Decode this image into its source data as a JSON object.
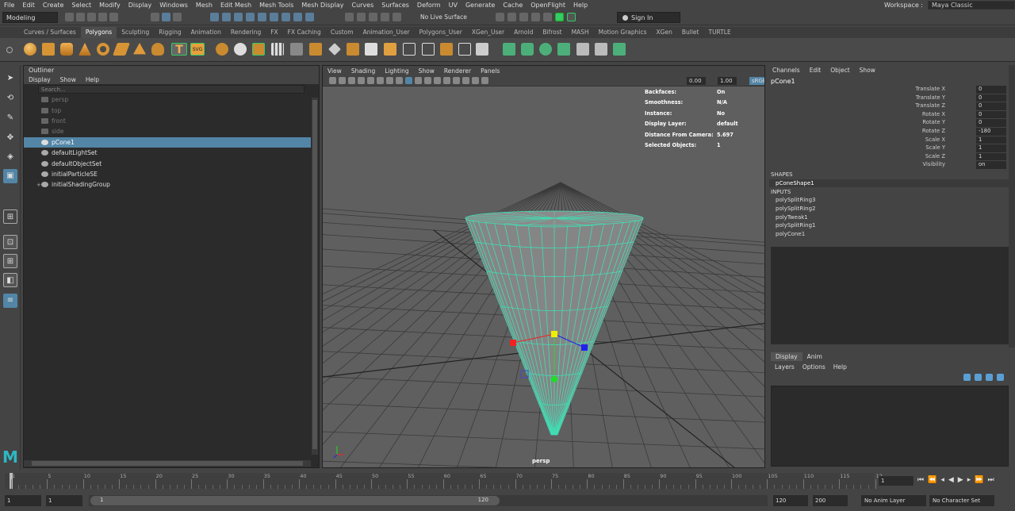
{
  "menubar": [
    "File",
    "Edit",
    "Create",
    "Select",
    "Modify",
    "Display",
    "Windows",
    "Mesh",
    "Edit Mesh",
    "Mesh Tools",
    "Mesh Display",
    "Curves",
    "Surfaces",
    "Deform",
    "UV",
    "Generate",
    "Cache",
    "OpenFlight",
    "Help"
  ],
  "workspace": {
    "label": "Workspace :",
    "value": "Maya Classic"
  },
  "status": {
    "mode": "Modeling",
    "live_surface": "No Live Surface",
    "sign_in": "Sign In"
  },
  "shelf_tabs": [
    "Curves / Surfaces",
    "Polygons",
    "Sculpting",
    "Rigging",
    "Animation",
    "Rendering",
    "FX",
    "FX Caching",
    "Custom",
    "Animation_User",
    "Polygons_User",
    "XGen_User",
    "Arnold",
    "Bifrost",
    "MASH",
    "Motion Graphics",
    "XGen",
    "Bullet",
    "TURTLE"
  ],
  "shelf_active": "Polygons",
  "shelf_icon_text": {
    "t": "T",
    "svg": "SVG"
  },
  "outliner": {
    "title": "Outliner",
    "menu": [
      "Display",
      "Show",
      "Help"
    ],
    "search_placeholder": "Search...",
    "items": [
      {
        "label": "persp",
        "state": "dim"
      },
      {
        "label": "top",
        "state": "dim"
      },
      {
        "label": "front",
        "state": "dim"
      },
      {
        "label": "side",
        "state": "dim"
      },
      {
        "label": "pCone1",
        "state": "selected"
      },
      {
        "label": "defaultLightSet",
        "state": "normal"
      },
      {
        "label": "defaultObjectSet",
        "state": "normal"
      },
      {
        "label": "initialParticleSE",
        "state": "normal"
      },
      {
        "label": "initialShadingGroup",
        "state": "normal"
      }
    ]
  },
  "viewport": {
    "menu": [
      "View",
      "Shading",
      "Lighting",
      "Show",
      "Renderer",
      "Panels"
    ],
    "field1": "0.00",
    "field2": "1.00",
    "field3": "sRGB",
    "camera": "persp",
    "hud": [
      {
        "label": "Backfaces:",
        "value": "On"
      },
      {
        "label": "Smoothness:",
        "value": "N/A"
      },
      {
        "label": "Instance:",
        "value": "No"
      },
      {
        "label": "Display Layer:",
        "value": "default"
      },
      {
        "label": "Distance From Camera:",
        "value": "5.697"
      },
      {
        "label": "Selected Objects:",
        "value": "1"
      }
    ]
  },
  "channel_box": {
    "menu": [
      "Channels",
      "Edit",
      "Object",
      "Show"
    ],
    "object": "pCone1",
    "channels": [
      {
        "label": "Translate X",
        "value": "0"
      },
      {
        "label": "Translate Y",
        "value": "0"
      },
      {
        "label": "Translate Z",
        "value": "0"
      },
      {
        "label": "Rotate X",
        "value": "0"
      },
      {
        "label": "Rotate Y",
        "value": "0"
      },
      {
        "label": "Rotate Z",
        "value": "-180"
      },
      {
        "label": "Scale X",
        "value": "1"
      },
      {
        "label": "Scale Y",
        "value": "1"
      },
      {
        "label": "Scale Z",
        "value": "1"
      },
      {
        "label": "Visibility",
        "value": "on"
      }
    ],
    "shapes_header": "SHAPES",
    "shape": "pConeShape1",
    "inputs_header": "INPUTS",
    "inputs": [
      "polySplitRing3",
      "polySplitRing2",
      "polyTweak1",
      "polySplitRing1",
      "polyCone1"
    ]
  },
  "layer_editor": {
    "tabs": [
      "Display",
      "Anim"
    ],
    "menu": [
      "Layers",
      "Options",
      "Help"
    ]
  },
  "timeline": {
    "ticks": [
      "1",
      "5",
      "10",
      "15",
      "20",
      "25",
      "30",
      "35",
      "40",
      "45",
      "50",
      "55",
      "60",
      "65",
      "70",
      "75",
      "80",
      "85",
      "90",
      "95",
      "100",
      "105",
      "110",
      "115",
      "12"
    ],
    "current_frame": "1"
  },
  "range": {
    "start": "1",
    "playback_start": "1",
    "slider_start": "1",
    "slider_end": "120",
    "playback_end": "120",
    "end": "200",
    "anim_layer": "No Anim Layer",
    "character_set": "No Character Set"
  },
  "colors": {
    "selection": "#5285a6",
    "wire": "#3ee0b5",
    "panel_bg": "#444444",
    "field_bg": "#2b2b2b"
  }
}
